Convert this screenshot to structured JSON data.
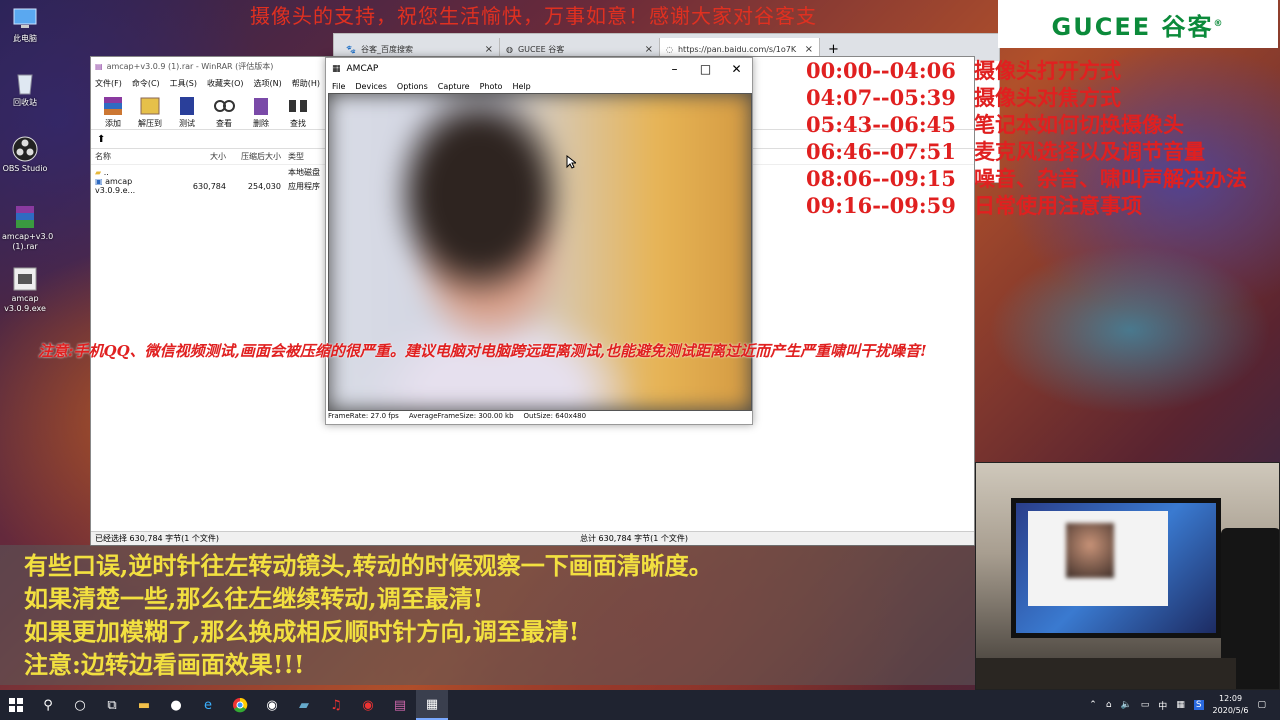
{
  "desktop": {
    "icons": [
      {
        "label": "此电脑",
        "name": "this-pc-icon"
      },
      {
        "label": "回收站",
        "name": "recycle-bin-icon"
      },
      {
        "label": "OBS Studio",
        "name": "obs-icon"
      },
      {
        "label": "amcap+v3.0 (1).rar",
        "name": "rar-file-icon"
      },
      {
        "label": "amcap v3.0.9.exe",
        "name": "exe-file-icon"
      }
    ]
  },
  "overlay": {
    "top_banner": "摄像头的支持，祝您生活愉快，万事如意！感谢大家对谷客支",
    "brand": "GUCEE 谷客",
    "brand_mark": "®",
    "timeline": [
      {
        "time": "00:00--04:06",
        "desc": "摄像头打开方式"
      },
      {
        "time": "04:07--05:39",
        "desc": "摄像头对焦方式"
      },
      {
        "time": "05:43--06:45",
        "desc": "笔记本如何切换摄像头"
      },
      {
        "time": "06:46--07:51",
        "desc": "麦克风选择以及调节音量"
      },
      {
        "time": "08:06--09:15",
        "desc": "噪音、杂音、啸叫声解决办法"
      },
      {
        "time": "09:16--09:59",
        "desc": "日常使用注意事项"
      }
    ],
    "warning": "注意:手机QQ、微信视频测试,画面会被压缩的很严重。建议电脑对电脑跨远距离测试,也能避免测试距离过近而产生严重啸叫干扰噪音!",
    "subtitles": [
      "有些口误,逆时针往左转动镜头,转动的时候观察一下画面清晰度。",
      "如果清楚一些,那么往左继续转动,调至最清!",
      "如果更加模糊了,那么换成相反顺时针方向,调至最清!",
      "注意:边转边看画面效果!!!"
    ]
  },
  "browser": {
    "tabs": [
      {
        "label": "谷客_百度搜索",
        "active": false
      },
      {
        "label": "GUCEE 谷客",
        "active": false
      },
      {
        "label": "https://pan.baidu.com/s/1o7K",
        "active": true
      }
    ],
    "new_tab": "+"
  },
  "winrar": {
    "title": "amcap+v3.0.9 (1).rar - WinRAR (评估版本)",
    "menu": [
      "文件(F)",
      "命令(C)",
      "工具(S)",
      "收藏夹(O)",
      "选项(N)",
      "帮助(H)"
    ],
    "tools": [
      {
        "label": "添加",
        "icon": "add-icon"
      },
      {
        "label": "解压到",
        "icon": "extract-icon"
      },
      {
        "label": "测试",
        "icon": "test-icon"
      },
      {
        "label": "查看",
        "icon": "view-icon"
      },
      {
        "label": "删除",
        "icon": "delete-icon"
      },
      {
        "label": "查找",
        "icon": "find-icon"
      }
    ],
    "columns": {
      "name": "名称",
      "size": "大小",
      "packed": "压缩后大小",
      "type": "类型"
    },
    "rows": [
      {
        "name": "..",
        "size": "",
        "packed": "",
        "type": "本地磁盘"
      },
      {
        "name": "amcap v3.0.9.e...",
        "size": "630,784",
        "packed": "254,030",
        "type": "应用程序"
      }
    ],
    "status_left": "已经选择 630,784 字节(1 个文件)",
    "status_right": "总计 630,784 字节(1 个文件)"
  },
  "amcap": {
    "title": "AMCAP",
    "menu": [
      "File",
      "Devices",
      "Options",
      "Capture",
      "Photo",
      "Help"
    ],
    "status": {
      "framerate": "FrameRate: 27.0 fps",
      "avg": "AverageFrameSize: 300.00 kb",
      "out": "OutSize: 640x480"
    }
  },
  "taskbar": {
    "tray_lang": "中",
    "clock_time": "12:09",
    "clock_date": "2020/5/6"
  },
  "colors": {
    "timeline": "#e02020",
    "subtitle": "#f2e040",
    "brand": "#0b8a3a"
  }
}
